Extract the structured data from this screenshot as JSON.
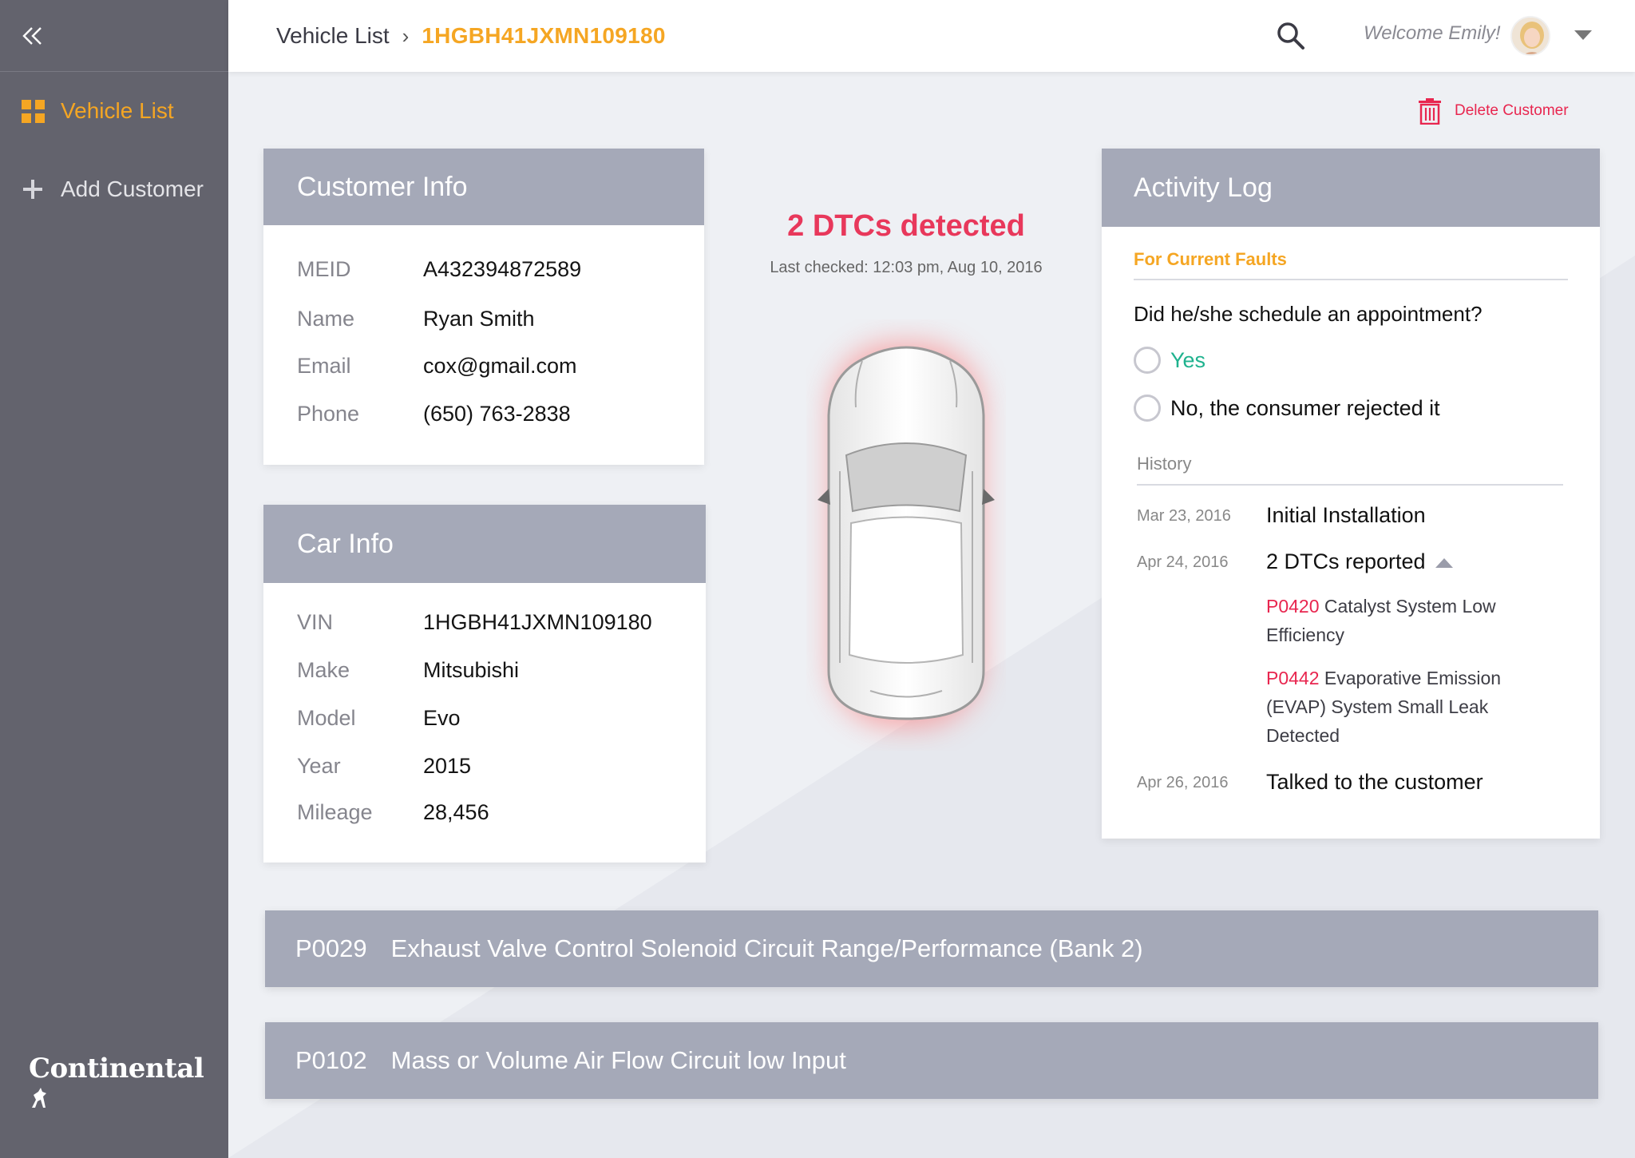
{
  "sidebar": {
    "items": [
      {
        "label": "Vehicle List",
        "icon": "grid-icon",
        "active": true
      },
      {
        "label": "Add Customer",
        "icon": "plus-icon",
        "active": false
      }
    ],
    "logo": "Continental"
  },
  "header": {
    "breadcrumb": [
      "Vehicle List",
      "1HGBH41JXMN109180"
    ],
    "welcome": "Welcome Emily!"
  },
  "actions": {
    "delete_customer": "Delete Customer"
  },
  "customer_info": {
    "title": "Customer Info",
    "rows": [
      {
        "label": "MEID",
        "value": "A432394872589"
      },
      {
        "label": "Name",
        "value": "Ryan Smith"
      },
      {
        "label": "Email",
        "value": "cox@gmail.com"
      },
      {
        "label": "Phone",
        "value": "(650) 763-2838"
      }
    ]
  },
  "car_info": {
    "title": "Car Info",
    "rows": [
      {
        "label": "VIN",
        "value": "1HGBH41JXMN109180"
      },
      {
        "label": "Make",
        "value": "Mitsubishi"
      },
      {
        "label": "Model",
        "value": "Evo"
      },
      {
        "label": "Year",
        "value": "2015"
      },
      {
        "label": "Mileage",
        "value": "28,456"
      }
    ]
  },
  "status": {
    "title": "2 DTCs detected",
    "last_checked": "Last checked: 12:03 pm, Aug 10, 2016"
  },
  "activity_log": {
    "title": "Activity Log",
    "section": "For Current Faults",
    "question": "Did he/she schedule an appointment?",
    "options": [
      "Yes",
      "No, the consumer rejected it"
    ],
    "history_label": "History",
    "history": [
      {
        "date": "Mar 23, 2016",
        "text": "Initial Installation"
      },
      {
        "date": "Apr 24, 2016",
        "text": "2 DTCs reported",
        "codes": [
          {
            "code": "P0420",
            "desc": "Catalyst System Low Efficiency"
          },
          {
            "code": "P0442",
            "desc": "Evaporative Emission (EVAP) System Small Leak Detected"
          }
        ]
      },
      {
        "date": "Apr 26, 2016",
        "text": "Talked to the customer"
      }
    ]
  },
  "dtcs": [
    {
      "code": "P0029",
      "desc": "Exhaust Valve Control Solenoid Circuit Range/Performance (Bank 2)"
    },
    {
      "code": "P0102",
      "desc": "Mass or Volume Air Flow Circuit low Input"
    }
  ],
  "colors": {
    "accent": "#f5a623",
    "alert": "#e8385b",
    "header_bar": "#a5a9b8",
    "sidebar": "#63636d",
    "success": "#1eb28e"
  }
}
